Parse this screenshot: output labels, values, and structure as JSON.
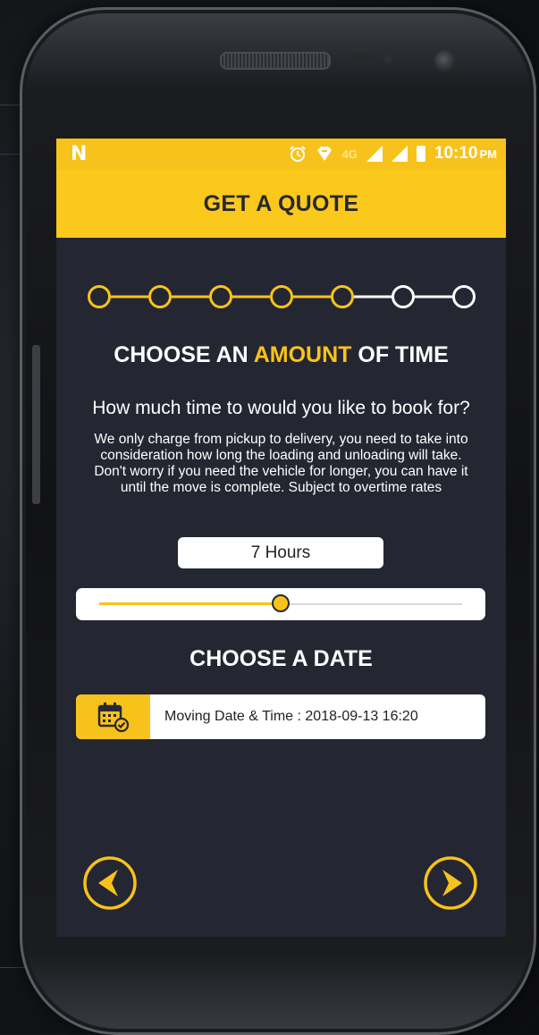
{
  "status_bar": {
    "left_icon": "N",
    "time": "10:10",
    "ampm": "PM",
    "network": "4G"
  },
  "header": {
    "title": "GET A QUOTE"
  },
  "stepper": {
    "total_steps": 7,
    "completed_steps": 5
  },
  "time_section": {
    "heading_prefix": "CHOOSE AN",
    "heading_accent": "AMOUNT",
    "heading_suffix": "OF TIME",
    "question": "How much time to would you like to book for?",
    "description": "We only charge from pickup to delivery, you need to take into consideration how long the loading and unloading will take. Don't worry if you need the vehicle for longer, you can have it until the move is complete. Subject to overtime rates",
    "value_display": "7 Hours",
    "slider_fraction": 0.5
  },
  "date_section": {
    "heading": "CHOOSE A DATE",
    "date_text": "Moving Date & Time : 2018-09-13 16:20"
  },
  "nav": {
    "back_icon": "chevron-left-icon",
    "next_icon": "chevron-right-icon"
  },
  "colors": {
    "accent": "#f7c21b",
    "screen_bg": "#242631",
    "active_step": "#f9c31b",
    "inactive_step": "#ffffff"
  }
}
